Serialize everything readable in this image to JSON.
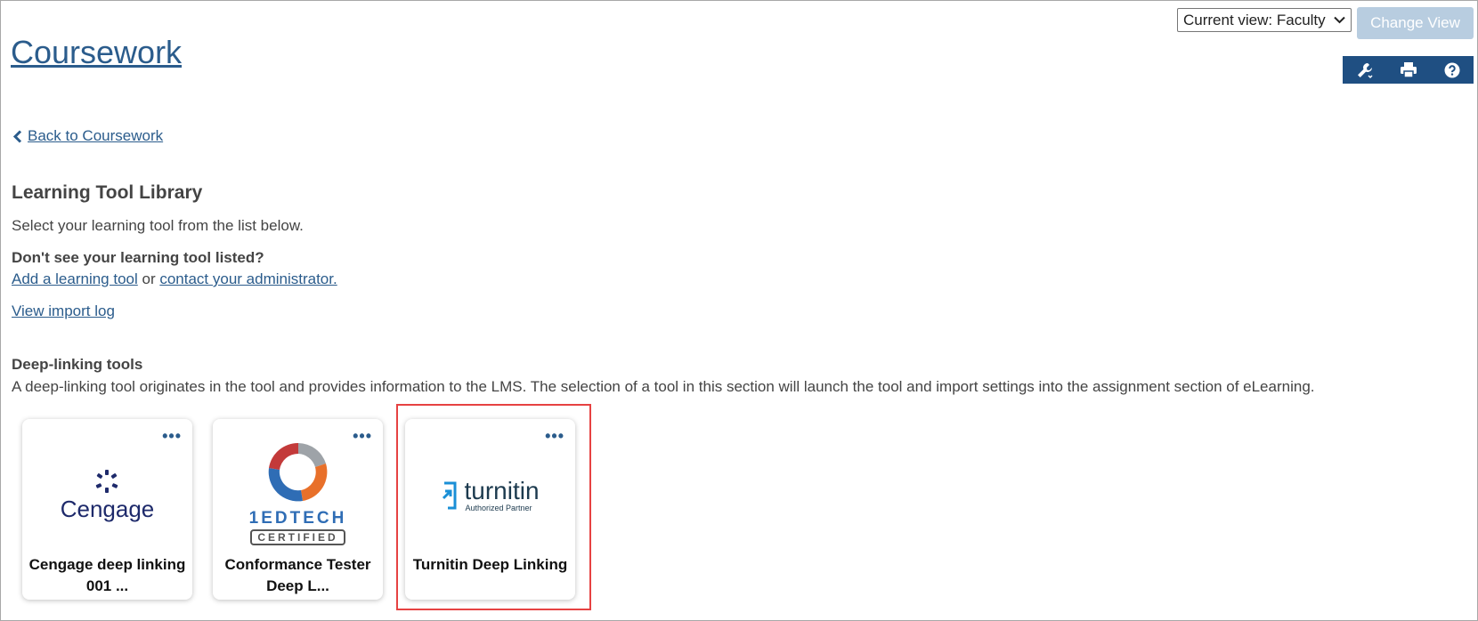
{
  "header": {
    "view_select": "Current view: Faculty",
    "change_view_label": "Change View",
    "title": "Coursework"
  },
  "toolbar": {
    "icons": [
      "wrench-icon",
      "printer-icon",
      "help-icon"
    ]
  },
  "nav": {
    "back_label": "Back to Coursework"
  },
  "library": {
    "title": "Learning Tool Library",
    "intro": "Select your learning tool from the list below.",
    "dont_see": "Don't see your learning tool listed?",
    "add_tool": "Add a learning tool",
    "or": " or ",
    "contact": "contact your administrator.",
    "import_log": "View import log"
  },
  "deep_linking": {
    "title": "Deep-linking tools",
    "description": "A deep-linking tool originates in the tool and provides information to the LMS. The selection of a tool in this section will launch the tool and import settings into the assignment section of eLearning.",
    "tools": [
      {
        "line1": "Cengage deep linking",
        "line2": "001 ...",
        "logo_text": "Cengage"
      },
      {
        "line1": "Conformance Tester",
        "line2": "Deep L...",
        "logo_text": "1EDTECH",
        "logo_sub": "CERTIFIED"
      },
      {
        "line1": "Turnitin Deep Linking",
        "line2": "",
        "logo_text": "turnitin",
        "logo_sub": "Authorized Partner"
      }
    ]
  },
  "colors": {
    "link": "#2b5c8c",
    "toolbar": "#1f4f82",
    "change_view": "#b8cde0",
    "highlight": "#e64242"
  }
}
